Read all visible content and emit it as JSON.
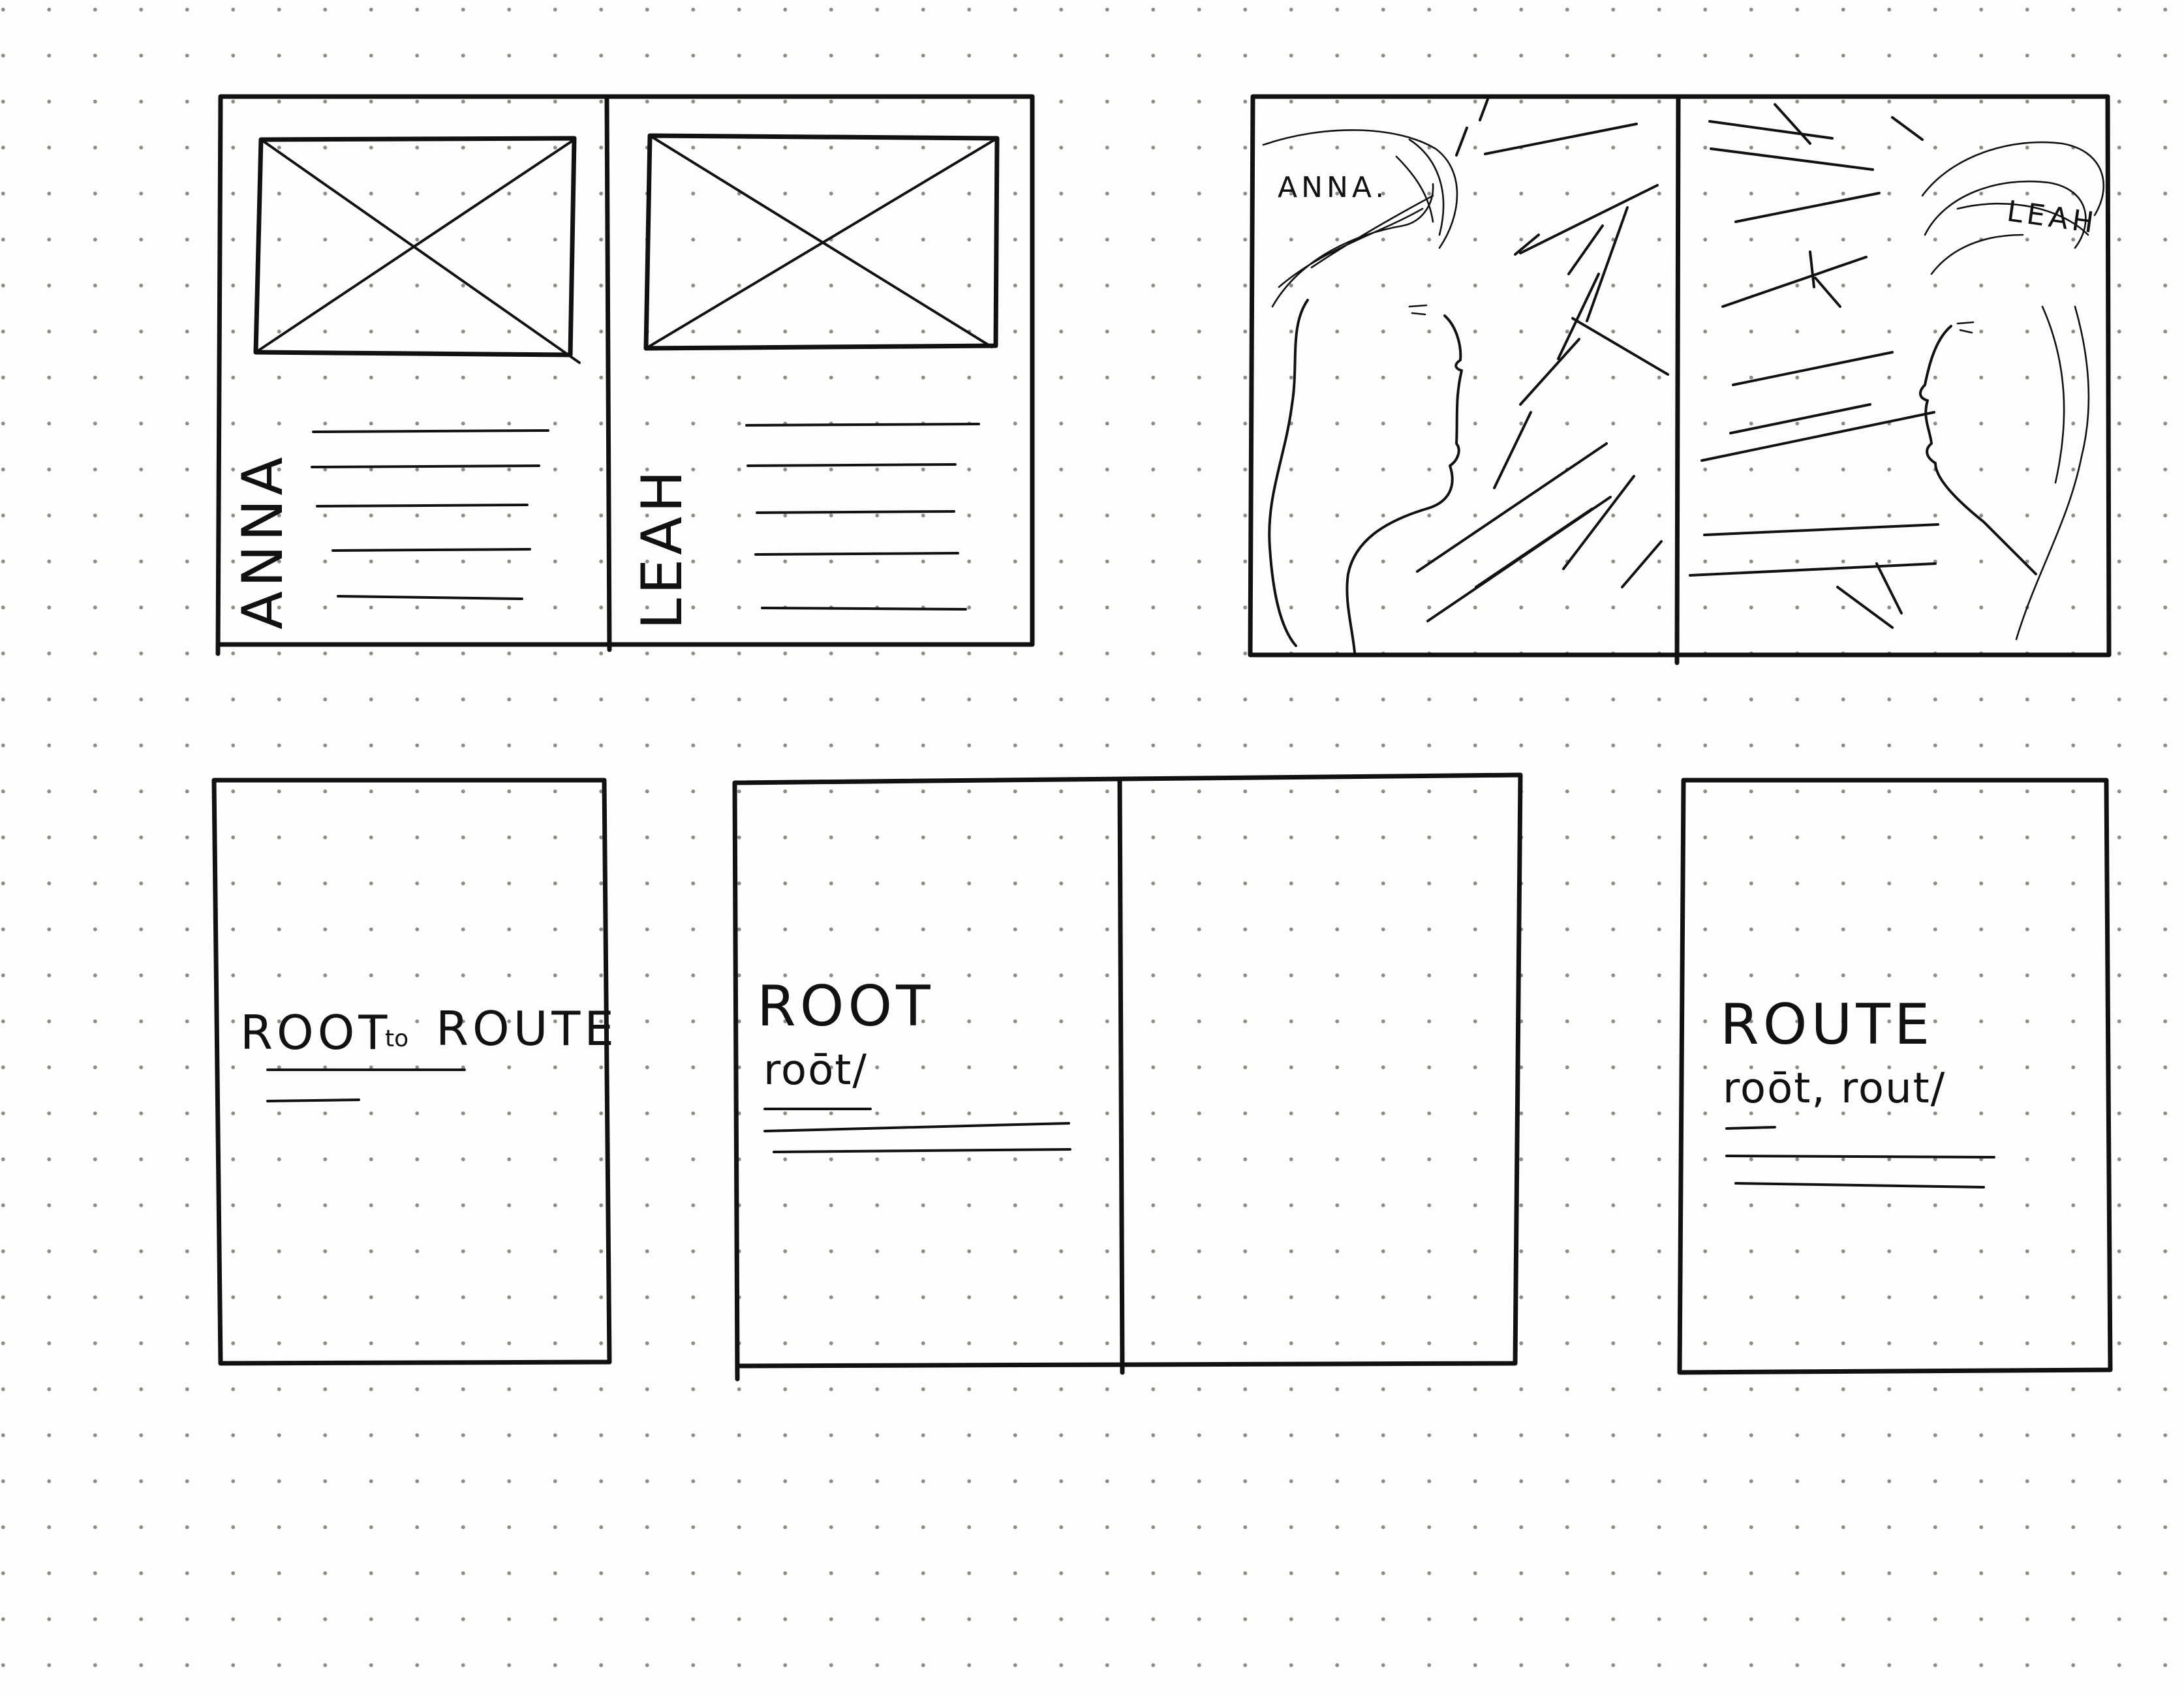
{
  "spread_top_left": {
    "left_page": {
      "name_vertical": "ANNA"
    },
    "right_page": {
      "name_vertical": "LEAH"
    }
  },
  "spread_top_right": {
    "left_panel": {
      "label": "ANNA."
    },
    "right_panel": {
      "label": "LEAH"
    }
  },
  "cover_page": {
    "title_start": "ROOT",
    "title_to": "to",
    "title_end": "ROUTE"
  },
  "spread_bottom_middle": {
    "word": "ROOT",
    "pronunciation": "roōt/"
  },
  "page_bottom_right": {
    "word": "ROUTE",
    "pronunciation": "roōt, rout/"
  },
  "colors": {
    "ink": "#111111",
    "paper": "#fdfdfb",
    "dots": "#8c8c88"
  }
}
